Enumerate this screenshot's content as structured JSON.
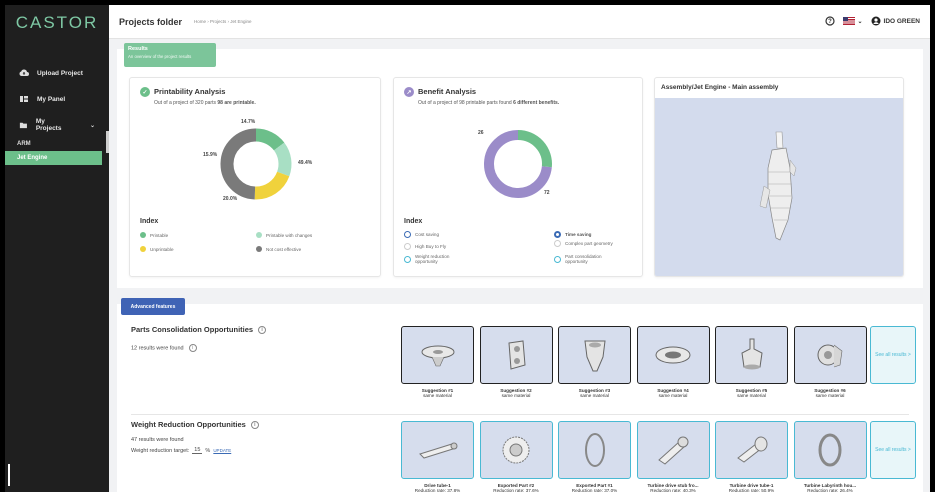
{
  "sidebar": {
    "logo": "CASTOR",
    "items": [
      {
        "label": "Upload Project",
        "icon": "cloud-upload-icon"
      },
      {
        "label": "My Panel",
        "icon": "panel-icon"
      },
      {
        "label": "My Projects",
        "icon": "folder-icon"
      }
    ],
    "sub_items": [
      {
        "label": "ARM",
        "active": false
      },
      {
        "label": "Jet Engine",
        "active": true
      }
    ]
  },
  "topbar": {
    "title": "Projects folder",
    "breadcrumb": "Home › Projects › Jet Engine",
    "user": "IDO GREEN",
    "help_icon": "help-icon",
    "flag_icon": "us-flag-icon"
  },
  "results": {
    "header_title": "Results",
    "header_sub": "An overview of the project results"
  },
  "printability": {
    "title": "Printability Analysis",
    "subtitle_pre": "Out of a project of 320 parts ",
    "subtitle_bold": "98 are printable.",
    "percent_labels": [
      "14.7%",
      "15.9%",
      "20.0%",
      "49.4%"
    ],
    "chart_data": {
      "type": "pie",
      "categories": [
        "Printable",
        "Printable with changes",
        "Unprintable",
        "Not cost effective"
      ],
      "values": [
        14.7,
        15.9,
        20.0,
        49.4
      ],
      "colors": [
        "#6cbf8a",
        "#a8dfc4",
        "#f0d23c",
        "#7a7a7a"
      ]
    },
    "index_title": "Index",
    "legend": [
      "Printable",
      "Printable with changes",
      "Unprintable",
      "Not cost effective"
    ]
  },
  "benefit": {
    "title": "Benefit Analysis",
    "subtitle_pre": "Out of a project of 98 printable parts found ",
    "subtitle_bold": "6 different benefits.",
    "value_labels": [
      "26",
      "72"
    ],
    "chart_data": {
      "type": "pie",
      "categories": [
        "Cost saving",
        "Time saving"
      ],
      "values": [
        26,
        72
      ],
      "colors": [
        "#6cbf8a",
        "#9b8cc9"
      ]
    },
    "index_title": "Index",
    "legend": [
      "Cost saving",
      "Time saving",
      "High Buy to Fly",
      "Complex part geometry",
      "Weight reduction opportunity",
      "Part consolidation opportunity"
    ]
  },
  "assembly": {
    "title": "Assembly/Jet Engine - Main assembly"
  },
  "advanced": {
    "badge": "Advanced features",
    "consolidation": {
      "title": "Parts Consolidation Opportunities",
      "count": "12 results were found",
      "tiles": [
        {
          "name": "Suggestion #1",
          "sub": "same material"
        },
        {
          "name": "Suggestion #2",
          "sub": "same material"
        },
        {
          "name": "Suggestion #3",
          "sub": "same material"
        },
        {
          "name": "Suggestion #4",
          "sub": "same material"
        },
        {
          "name": "Suggestion #5",
          "sub": "same material"
        },
        {
          "name": "Suggestion #6",
          "sub": "same material"
        }
      ],
      "see_all": "See all results >"
    },
    "weight": {
      "title": "Weight Reduction Opportunities",
      "count": "47 results were found",
      "target_label": "Weight reduction target:",
      "target_value": "15",
      "target_unit": "%",
      "update": "UPDATE",
      "tiles": [
        {
          "name": "Drive tube-1",
          "sub": "Reduction rate: 37.8%"
        },
        {
          "name": "Exported Part #2",
          "sub": "Reduction rate: 37.6%"
        },
        {
          "name": "Exported Part #1",
          "sub": "Reduction rate: 37.0%"
        },
        {
          "name": "Turbine drive stub fro...",
          "sub": "Reduction rate: 40.3%"
        },
        {
          "name": "Turbine drive tube-1",
          "sub": "Reduction rate: 50.9%"
        },
        {
          "name": "Turbine Labyrinth hou...",
          "sub": "Reduction rate: 26.4%"
        }
      ],
      "see_all": "See all results >"
    }
  }
}
